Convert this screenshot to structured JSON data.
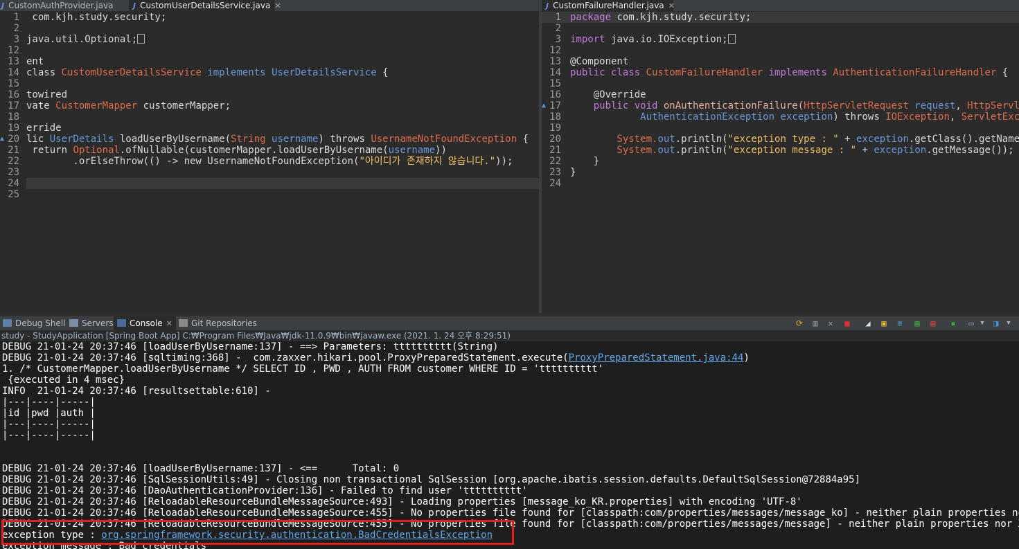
{
  "left_editor": {
    "tabs": [
      {
        "label": "CustomAuthProvider.java",
        "active": false
      },
      {
        "label": "CustomUserDetailsService.java",
        "active": true,
        "close": "✕"
      }
    ],
    "lines": [
      {
        "num": "1",
        "marker": ""
      },
      {
        "num": "2",
        "marker": ""
      },
      {
        "num": "3",
        "marker": "⊕"
      },
      {
        "num": "12",
        "marker": ""
      },
      {
        "num": "13",
        "marker": ""
      },
      {
        "num": "14",
        "marker": ""
      },
      {
        "num": "15",
        "marker": ""
      },
      {
        "num": "16",
        "marker": "⊖"
      },
      {
        "num": "17",
        "marker": ""
      },
      {
        "num": "18",
        "marker": ""
      },
      {
        "num": "19",
        "marker": "⊖"
      },
      {
        "num": "20",
        "marker": "▲"
      },
      {
        "num": "21",
        "marker": ""
      },
      {
        "num": "22",
        "marker": ""
      },
      {
        "num": "23",
        "marker": ""
      },
      {
        "num": "24",
        "marker": ""
      },
      {
        "num": "25",
        "marker": ""
      }
    ],
    "code": {
      "l1": " com.kjh.study.security;",
      "l3": "java.util.Optional;",
      "l13": "ent",
      "l14_a": "class ",
      "l14_b": "CustomUserDetailsService",
      "l14_c": " implements ",
      "l14_d": "UserDetailsService",
      "l14_e": " {",
      "l16": "towired",
      "l17_a": "vate ",
      "l17_b": "CustomerMapper",
      "l17_c": " customerMapper;",
      "l19": "erride",
      "l20_a": "lic ",
      "l20_b": "UserDetails",
      "l20_c": " loadUserByUsername(",
      "l20_d": "String",
      "l20_e": " username",
      "l20_f": ") throws ",
      "l20_g": "UsernameNotFoundException",
      "l20_h": " {",
      "l21_a": " return ",
      "l21_b": "Optional",
      "l21_c": ".ofNullable(customerMapper.loadUserByUsername(",
      "l21_d": "username",
      "l21_e": "))",
      "l22_a": "        .orElseThrow(() -> new ",
      "l22_b": "UsernameNotFoundException",
      "l22_c": "(",
      "l22_d": "\"아이디가 존재하지 않습니다.\"",
      "l22_e": "));"
    }
  },
  "right_editor": {
    "tabs": [
      {
        "label": "CustomFailureHandler.java",
        "active": true,
        "close": "✕"
      }
    ],
    "lines": [
      {
        "num": "1",
        "marker": ""
      },
      {
        "num": "2",
        "marker": ""
      },
      {
        "num": "3",
        "marker": "⊕"
      },
      {
        "num": "12",
        "marker": ""
      },
      {
        "num": "13",
        "marker": ""
      },
      {
        "num": "14",
        "marker": ""
      },
      {
        "num": "15",
        "marker": ""
      },
      {
        "num": "16",
        "marker": "⊖"
      },
      {
        "num": "17",
        "marker": "▲"
      },
      {
        "num": "18",
        "marker": ""
      },
      {
        "num": "19",
        "marker": ""
      },
      {
        "num": "20",
        "marker": ""
      },
      {
        "num": "21",
        "marker": ""
      },
      {
        "num": "22",
        "marker": ""
      },
      {
        "num": "23",
        "marker": ""
      },
      {
        "num": "24",
        "marker": ""
      }
    ],
    "code": {
      "l1_a": "package ",
      "l1_b": "com.kjh.study.security;",
      "l3_a": "import ",
      "l3_b": "java.io.IOException;",
      "l13": "@Component",
      "l14_a": "public class ",
      "l14_b": "CustomFailureHandler",
      "l14_c": " implements ",
      "l14_d": "AuthenticationFailureHandler",
      "l14_e": " {",
      "l16": "    @Override",
      "l17_a": "    public void ",
      "l17_b": "onAuthenticationFailure(",
      "l17_c": "HttpServletRequest",
      "l17_d": " request",
      "l17_e": ", ",
      "l17_f": "HttpServletRe",
      "l18_a": "            ",
      "l18_b": "AuthenticationException",
      "l18_c": " exception",
      "l18_d": ") throws ",
      "l18_e": "IOException",
      "l18_f": ", ",
      "l18_g": "ServletExcepti",
      "l20_a": "        System.",
      "l20_b": "out",
      "l20_c": ".println(",
      "l20_d": "\"exception type : \"",
      "l20_e": " + ",
      "l20_f": "exception",
      "l20_g": ".getClass().getName());",
      "l21_a": "        System.",
      "l21_b": "out",
      "l21_c": ".println(",
      "l21_d": "\"exception message : \"",
      "l21_e": " + ",
      "l21_f": "exception",
      "l21_g": ".getMessage());",
      "l22": "    }",
      "l23": "}"
    }
  },
  "views": {
    "tabs": [
      {
        "label": "Debug Shell",
        "active": false
      },
      {
        "label": "Servers",
        "active": false
      },
      {
        "label": "Console",
        "active": true,
        "close": "✕"
      },
      {
        "label": "Git Repositories",
        "active": false
      }
    ]
  },
  "console": {
    "title": "study - StudyApplication [Spring Boot App] C:₩Program Files₩Java₩jdk-11.0.9₩bin₩javaw.exe  (2021. 1. 24 오후 8:29:51)",
    "lines": [
      "DEBUG 21-01-24 20:37:46 [loadUserByUsername:137] - ==> Parameters: tttttttttt(String)",
      "DEBUG 21-01-24 20:37:46 [sqltiming:368] -  com.zaxxer.hikari.pool.ProxyPreparedStatement.execute(",
      "1. /* CustomerMapper.loadUserByUsername */ SELECT ID , PWD , AUTH FROM customer WHERE ID = 'tttttttttt'",
      " {executed in 4 msec}",
      "INFO  21-01-24 20:37:46 [resultsettable:610] -",
      "|---|----|-----|",
      "|id |pwd |auth |",
      "|---|----|-----|",
      "|---|----|-----|",
      "",
      "",
      "DEBUG 21-01-24 20:37:46 [loadUserByUsername:137] - <==      Total: 0",
      "DEBUG 21-01-24 20:37:46 [SqlSessionUtils:49] - Closing non transactional SqlSession [org.apache.ibatis.session.defaults.DefaultSqlSession@72884a95]",
      "DEBUG 21-01-24 20:37:46 [DaoAuthenticationProvider:136] - Failed to find user 'tttttttttt'",
      "DEBUG 21-01-24 20:37:46 [ReloadableResourceBundleMessageSource:493] - Loading properties [message_ko_KR.properties] with encoding 'UTF-8'",
      "DEBUG 21-01-24 20:37:46 [ReloadableResourceBundleMessageSource:455] - No properties file found for [classpath:com/properties/messages/message_ko] - neither plain properties nor XML",
      "DEBUG 21-01-24 20:37:46 [ReloadableResourceBundleMessageSource:455] - No properties file found for [classpath:com/properties/messages/message] - neither plain properties nor XML"
    ],
    "sql_link": "ProxyPreparedStatement.java:44",
    "sql_link_close": ")",
    "exc_type_label": "exception type : ",
    "exc_type_link": "org.springframework.security.authentication.BadCredentialsException",
    "exc_message": "exception message : Bad credentials"
  },
  "colors": {
    "highlight_box": "#e01f1f",
    "link": "#5ea6ea",
    "background": "#2b2b2b"
  }
}
